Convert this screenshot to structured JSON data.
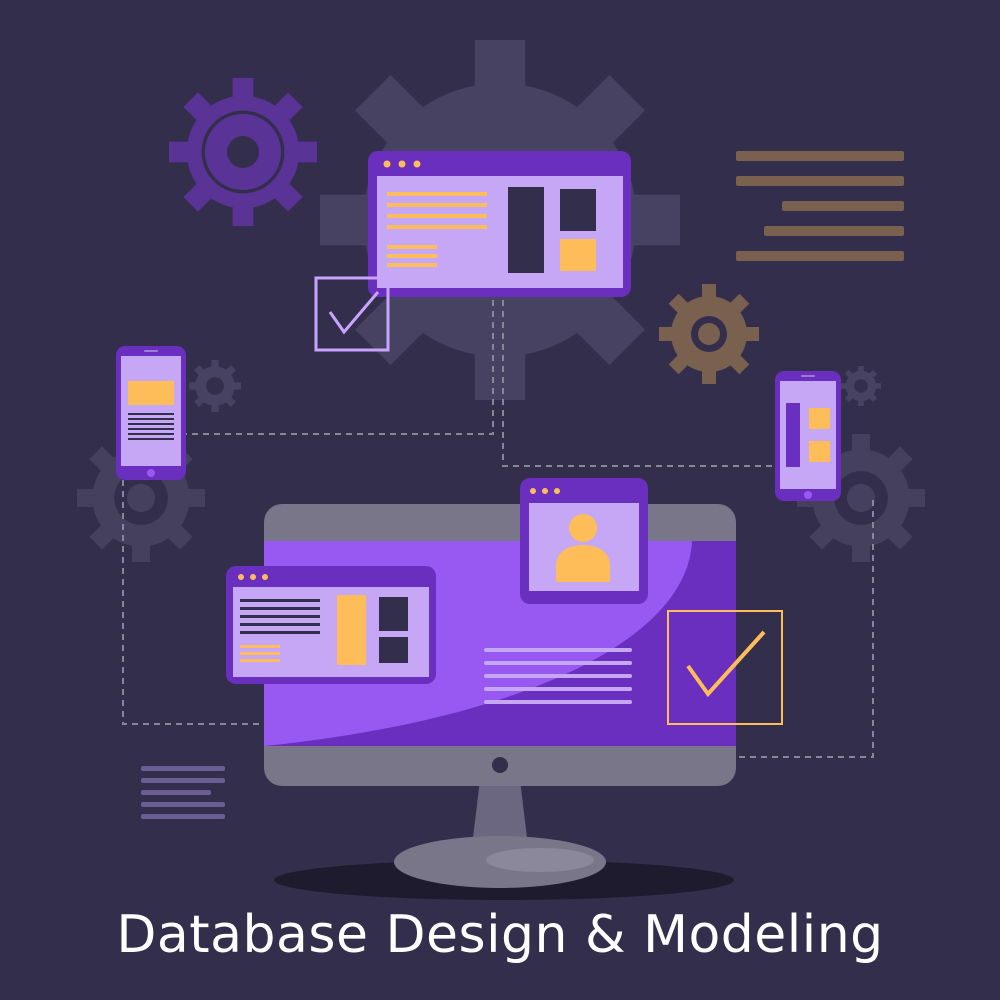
{
  "caption": "Database Design & Modeling",
  "colors": {
    "background": "#342e4d",
    "gear_large": "#474262",
    "gear_purple": "#5a3396",
    "gear_brown": "#7a604e",
    "gear_dark": "#45405e",
    "window_frame": "#6a2fbf",
    "window_body": "#c5a7f5",
    "accent_yellow": "#ffbd59",
    "dark_block": "#342e4d",
    "screen_light": "#9859f2",
    "screen_dark": "#6a2fbf",
    "monitor_gray": "#7a7689",
    "check_outline": "#c9a4ff",
    "text_lines_brown": "#7a604e",
    "text_lines_purple": "#6b5e92",
    "dashed_connector": "#8a8599"
  },
  "icons": {
    "check": "checkmark-icon",
    "user": "user-avatar-icon",
    "gear": "gear-icon"
  }
}
